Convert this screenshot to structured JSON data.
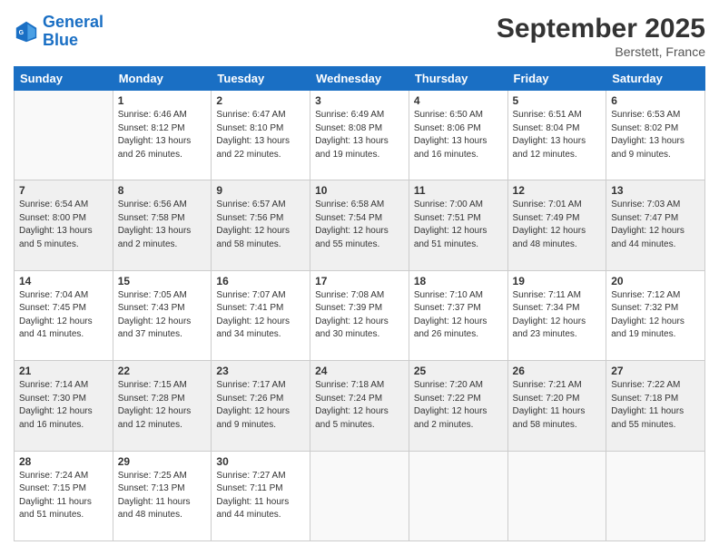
{
  "logo": {
    "line1": "General",
    "line2": "Blue"
  },
  "title": "September 2025",
  "location": "Berstett, France",
  "headers": [
    "Sunday",
    "Monday",
    "Tuesday",
    "Wednesday",
    "Thursday",
    "Friday",
    "Saturday"
  ],
  "rows": [
    [
      {
        "day": "",
        "info": ""
      },
      {
        "day": "1",
        "info": "Sunrise: 6:46 AM\nSunset: 8:12 PM\nDaylight: 13 hours\nand 26 minutes."
      },
      {
        "day": "2",
        "info": "Sunrise: 6:47 AM\nSunset: 8:10 PM\nDaylight: 13 hours\nand 22 minutes."
      },
      {
        "day": "3",
        "info": "Sunrise: 6:49 AM\nSunset: 8:08 PM\nDaylight: 13 hours\nand 19 minutes."
      },
      {
        "day": "4",
        "info": "Sunrise: 6:50 AM\nSunset: 8:06 PM\nDaylight: 13 hours\nand 16 minutes."
      },
      {
        "day": "5",
        "info": "Sunrise: 6:51 AM\nSunset: 8:04 PM\nDaylight: 13 hours\nand 12 minutes."
      },
      {
        "day": "6",
        "info": "Sunrise: 6:53 AM\nSunset: 8:02 PM\nDaylight: 13 hours\nand 9 minutes."
      }
    ],
    [
      {
        "day": "7",
        "info": "Sunrise: 6:54 AM\nSunset: 8:00 PM\nDaylight: 13 hours\nand 5 minutes."
      },
      {
        "day": "8",
        "info": "Sunrise: 6:56 AM\nSunset: 7:58 PM\nDaylight: 13 hours\nand 2 minutes."
      },
      {
        "day": "9",
        "info": "Sunrise: 6:57 AM\nSunset: 7:56 PM\nDaylight: 12 hours\nand 58 minutes."
      },
      {
        "day": "10",
        "info": "Sunrise: 6:58 AM\nSunset: 7:54 PM\nDaylight: 12 hours\nand 55 minutes."
      },
      {
        "day": "11",
        "info": "Sunrise: 7:00 AM\nSunset: 7:51 PM\nDaylight: 12 hours\nand 51 minutes."
      },
      {
        "day": "12",
        "info": "Sunrise: 7:01 AM\nSunset: 7:49 PM\nDaylight: 12 hours\nand 48 minutes."
      },
      {
        "day": "13",
        "info": "Sunrise: 7:03 AM\nSunset: 7:47 PM\nDaylight: 12 hours\nand 44 minutes."
      }
    ],
    [
      {
        "day": "14",
        "info": "Sunrise: 7:04 AM\nSunset: 7:45 PM\nDaylight: 12 hours\nand 41 minutes."
      },
      {
        "day": "15",
        "info": "Sunrise: 7:05 AM\nSunset: 7:43 PM\nDaylight: 12 hours\nand 37 minutes."
      },
      {
        "day": "16",
        "info": "Sunrise: 7:07 AM\nSunset: 7:41 PM\nDaylight: 12 hours\nand 34 minutes."
      },
      {
        "day": "17",
        "info": "Sunrise: 7:08 AM\nSunset: 7:39 PM\nDaylight: 12 hours\nand 30 minutes."
      },
      {
        "day": "18",
        "info": "Sunrise: 7:10 AM\nSunset: 7:37 PM\nDaylight: 12 hours\nand 26 minutes."
      },
      {
        "day": "19",
        "info": "Sunrise: 7:11 AM\nSunset: 7:34 PM\nDaylight: 12 hours\nand 23 minutes."
      },
      {
        "day": "20",
        "info": "Sunrise: 7:12 AM\nSunset: 7:32 PM\nDaylight: 12 hours\nand 19 minutes."
      }
    ],
    [
      {
        "day": "21",
        "info": "Sunrise: 7:14 AM\nSunset: 7:30 PM\nDaylight: 12 hours\nand 16 minutes."
      },
      {
        "day": "22",
        "info": "Sunrise: 7:15 AM\nSunset: 7:28 PM\nDaylight: 12 hours\nand 12 minutes."
      },
      {
        "day": "23",
        "info": "Sunrise: 7:17 AM\nSunset: 7:26 PM\nDaylight: 12 hours\nand 9 minutes."
      },
      {
        "day": "24",
        "info": "Sunrise: 7:18 AM\nSunset: 7:24 PM\nDaylight: 12 hours\nand 5 minutes."
      },
      {
        "day": "25",
        "info": "Sunrise: 7:20 AM\nSunset: 7:22 PM\nDaylight: 12 hours\nand 2 minutes."
      },
      {
        "day": "26",
        "info": "Sunrise: 7:21 AM\nSunset: 7:20 PM\nDaylight: 11 hours\nand 58 minutes."
      },
      {
        "day": "27",
        "info": "Sunrise: 7:22 AM\nSunset: 7:18 PM\nDaylight: 11 hours\nand 55 minutes."
      }
    ],
    [
      {
        "day": "28",
        "info": "Sunrise: 7:24 AM\nSunset: 7:15 PM\nDaylight: 11 hours\nand 51 minutes."
      },
      {
        "day": "29",
        "info": "Sunrise: 7:25 AM\nSunset: 7:13 PM\nDaylight: 11 hours\nand 48 minutes."
      },
      {
        "day": "30",
        "info": "Sunrise: 7:27 AM\nSunset: 7:11 PM\nDaylight: 11 hours\nand 44 minutes."
      },
      {
        "day": "",
        "info": ""
      },
      {
        "day": "",
        "info": ""
      },
      {
        "day": "",
        "info": ""
      },
      {
        "day": "",
        "info": ""
      }
    ]
  ]
}
